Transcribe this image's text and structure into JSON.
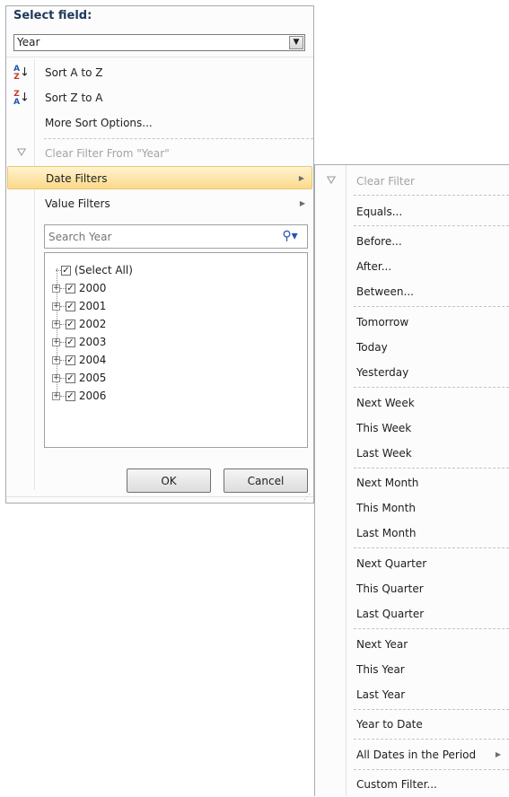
{
  "panel": {
    "select_field_label": "Select field:",
    "field_value": "Year"
  },
  "menu": {
    "sort_az": "Sort A to Z",
    "sort_za": "Sort Z to A",
    "more_sort": "More Sort Options...",
    "clear_filter_from": "Clear Filter From \"Year\"",
    "date_filters": "Date Filters",
    "value_filters": "Value Filters"
  },
  "search": {
    "placeholder": "Search Year"
  },
  "tree": {
    "items": [
      {
        "label": "(Select All)",
        "checked": true
      },
      {
        "label": "2000",
        "checked": true
      },
      {
        "label": "2001",
        "checked": true
      },
      {
        "label": "2002",
        "checked": true
      },
      {
        "label": "2003",
        "checked": true
      },
      {
        "label": "2004",
        "checked": true
      },
      {
        "label": "2005",
        "checked": true
      },
      {
        "label": "2006",
        "checked": true
      }
    ]
  },
  "buttons": {
    "ok": "OK",
    "cancel": "Cancel"
  },
  "submenu": {
    "items": [
      "Clear Filter",
      "Equals...",
      "Before...",
      "After...",
      "Between...",
      "Tomorrow",
      "Today",
      "Yesterday",
      "Next Week",
      "This Week",
      "Last Week",
      "Next Month",
      "This Month",
      "Last Month",
      "Next Quarter",
      "This Quarter",
      "Last Quarter",
      "Next Year",
      "This Year",
      "Last Year",
      "Year to Date",
      "All Dates in the Period",
      "Custom Filter..."
    ]
  },
  "colors": {
    "highlight_top": "#fff3cf",
    "highlight_bottom": "#fbd98a",
    "disabled_text": "#a3a3a3",
    "label_blue": "#1e395b"
  }
}
